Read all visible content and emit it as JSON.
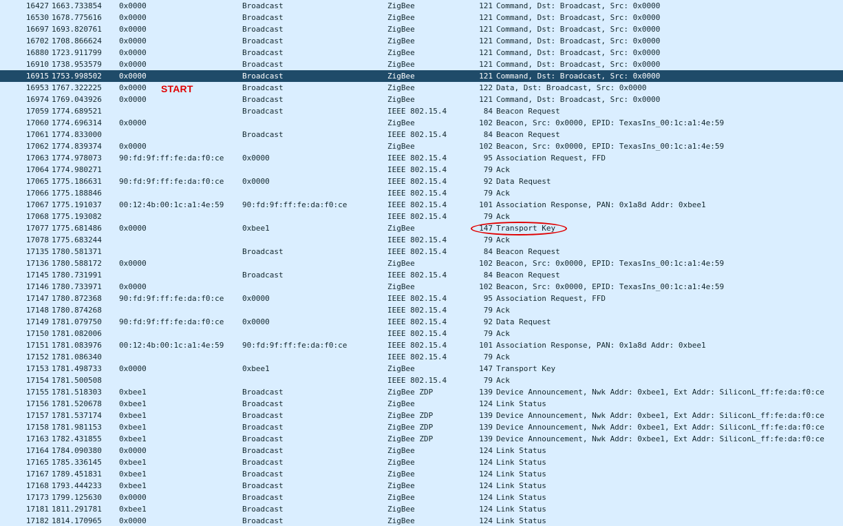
{
  "annotations": {
    "start_label": "START",
    "circle_color": "#e00000"
  },
  "colors": {
    "row_bg": "#daeeff",
    "selected_bg": "#1f4b69"
  },
  "selected_row": 6,
  "packets": [
    {
      "no": "16427",
      "time": "1663.733854",
      "src": "0x0000",
      "dst": "Broadcast",
      "proto": "ZigBee",
      "len": "121",
      "info": "Command, Dst: Broadcast, Src: 0x0000"
    },
    {
      "no": "16530",
      "time": "1678.775616",
      "src": "0x0000",
      "dst": "Broadcast",
      "proto": "ZigBee",
      "len": "121",
      "info": "Command, Dst: Broadcast, Src: 0x0000"
    },
    {
      "no": "16697",
      "time": "1693.820761",
      "src": "0x0000",
      "dst": "Broadcast",
      "proto": "ZigBee",
      "len": "121",
      "info": "Command, Dst: Broadcast, Src: 0x0000"
    },
    {
      "no": "16702",
      "time": "1708.866624",
      "src": "0x0000",
      "dst": "Broadcast",
      "proto": "ZigBee",
      "len": "121",
      "info": "Command, Dst: Broadcast, Src: 0x0000"
    },
    {
      "no": "16880",
      "time": "1723.911799",
      "src": "0x0000",
      "dst": "Broadcast",
      "proto": "ZigBee",
      "len": "121",
      "info": "Command, Dst: Broadcast, Src: 0x0000"
    },
    {
      "no": "16910",
      "time": "1738.953579",
      "src": "0x0000",
      "dst": "Broadcast",
      "proto": "ZigBee",
      "len": "121",
      "info": "Command, Dst: Broadcast, Src: 0x0000"
    },
    {
      "no": "16915",
      "time": "1753.998502",
      "src": "0x0000",
      "dst": "Broadcast",
      "proto": "ZigBee",
      "len": "121",
      "info": "Command, Dst: Broadcast, Src: 0x0000"
    },
    {
      "no": "16953",
      "time": "1767.322225",
      "src": "0x0000",
      "dst": "Broadcast",
      "proto": "ZigBee",
      "len": "122",
      "info": "Data, Dst: Broadcast, Src: 0x0000"
    },
    {
      "no": "16974",
      "time": "1769.043926",
      "src": "0x0000",
      "dst": "Broadcast",
      "proto": "ZigBee",
      "len": "121",
      "info": "Command, Dst: Broadcast, Src: 0x0000"
    },
    {
      "no": "17059",
      "time": "1774.689521",
      "src": "",
      "dst": "Broadcast",
      "proto": "IEEE 802.15.4",
      "len": "84",
      "info": "Beacon Request"
    },
    {
      "no": "17060",
      "time": "1774.696314",
      "src": "0x0000",
      "dst": "",
      "proto": "ZigBee",
      "len": "102",
      "info": "Beacon, Src: 0x0000, EPID: TexasIns_00:1c:a1:4e:59"
    },
    {
      "no": "17061",
      "time": "1774.833000",
      "src": "",
      "dst": "Broadcast",
      "proto": "IEEE 802.15.4",
      "len": "84",
      "info": "Beacon Request"
    },
    {
      "no": "17062",
      "time": "1774.839374",
      "src": "0x0000",
      "dst": "",
      "proto": "ZigBee",
      "len": "102",
      "info": "Beacon, Src: 0x0000, EPID: TexasIns_00:1c:a1:4e:59"
    },
    {
      "no": "17063",
      "time": "1774.978073",
      "src": "90:fd:9f:ff:fe:da:f0:ce",
      "dst": "0x0000",
      "proto": "IEEE 802.15.4",
      "len": "95",
      "info": "Association Request, FFD"
    },
    {
      "no": "17064",
      "time": "1774.980271",
      "src": "",
      "dst": "",
      "proto": "IEEE 802.15.4",
      "len": "79",
      "info": "Ack"
    },
    {
      "no": "17065",
      "time": "1775.186631",
      "src": "90:fd:9f:ff:fe:da:f0:ce",
      "dst": "0x0000",
      "proto": "IEEE 802.15.4",
      "len": "92",
      "info": "Data Request"
    },
    {
      "no": "17066",
      "time": "1775.188846",
      "src": "",
      "dst": "",
      "proto": "IEEE 802.15.4",
      "len": "79",
      "info": "Ack"
    },
    {
      "no": "17067",
      "time": "1775.191037",
      "src": "00:12:4b:00:1c:a1:4e:59",
      "dst": "90:fd:9f:ff:fe:da:f0:ce",
      "proto": "IEEE 802.15.4",
      "len": "101",
      "info": "Association Response, PAN: 0x1a8d Addr: 0xbee1"
    },
    {
      "no": "17068",
      "time": "1775.193082",
      "src": "",
      "dst": "",
      "proto": "IEEE 802.15.4",
      "len": "79",
      "info": "Ack"
    },
    {
      "no": "17077",
      "time": "1775.681486",
      "src": "0x0000",
      "dst": "0xbee1",
      "proto": "ZigBee",
      "len": "147",
      "info": "Transport Key"
    },
    {
      "no": "17078",
      "time": "1775.683244",
      "src": "",
      "dst": "",
      "proto": "IEEE 802.15.4",
      "len": "79",
      "info": "Ack"
    },
    {
      "no": "17135",
      "time": "1780.581371",
      "src": "",
      "dst": "Broadcast",
      "proto": "IEEE 802.15.4",
      "len": "84",
      "info": "Beacon Request"
    },
    {
      "no": "17136",
      "time": "1780.588172",
      "src": "0x0000",
      "dst": "",
      "proto": "ZigBee",
      "len": "102",
      "info": "Beacon, Src: 0x0000, EPID: TexasIns_00:1c:a1:4e:59"
    },
    {
      "no": "17145",
      "time": "1780.731991",
      "src": "",
      "dst": "Broadcast",
      "proto": "IEEE 802.15.4",
      "len": "84",
      "info": "Beacon Request"
    },
    {
      "no": "17146",
      "time": "1780.733971",
      "src": "0x0000",
      "dst": "",
      "proto": "ZigBee",
      "len": "102",
      "info": "Beacon, Src: 0x0000, EPID: TexasIns_00:1c:a1:4e:59"
    },
    {
      "no": "17147",
      "time": "1780.872368",
      "src": "90:fd:9f:ff:fe:da:f0:ce",
      "dst": "0x0000",
      "proto": "IEEE 802.15.4",
      "len": "95",
      "info": "Association Request, FFD"
    },
    {
      "no": "17148",
      "time": "1780.874268",
      "src": "",
      "dst": "",
      "proto": "IEEE 802.15.4",
      "len": "79",
      "info": "Ack"
    },
    {
      "no": "17149",
      "time": "1781.079750",
      "src": "90:fd:9f:ff:fe:da:f0:ce",
      "dst": "0x0000",
      "proto": "IEEE 802.15.4",
      "len": "92",
      "info": "Data Request"
    },
    {
      "no": "17150",
      "time": "1781.082006",
      "src": "",
      "dst": "",
      "proto": "IEEE 802.15.4",
      "len": "79",
      "info": "Ack"
    },
    {
      "no": "17151",
      "time": "1781.083976",
      "src": "00:12:4b:00:1c:a1:4e:59",
      "dst": "90:fd:9f:ff:fe:da:f0:ce",
      "proto": "IEEE 802.15.4",
      "len": "101",
      "info": "Association Response, PAN: 0x1a8d Addr: 0xbee1"
    },
    {
      "no": "17152",
      "time": "1781.086340",
      "src": "",
      "dst": "",
      "proto": "IEEE 802.15.4",
      "len": "79",
      "info": "Ack"
    },
    {
      "no": "17153",
      "time": "1781.498733",
      "src": "0x0000",
      "dst": "0xbee1",
      "proto": "ZigBee",
      "len": "147",
      "info": "Transport Key"
    },
    {
      "no": "17154",
      "time": "1781.500508",
      "src": "",
      "dst": "",
      "proto": "IEEE 802.15.4",
      "len": "79",
      "info": "Ack"
    },
    {
      "no": "17155",
      "time": "1781.518303",
      "src": "0xbee1",
      "dst": "Broadcast",
      "proto": "ZigBee ZDP",
      "len": "139",
      "info": "Device Announcement, Nwk Addr: 0xbee1, Ext Addr: SiliconL_ff:fe:da:f0:ce"
    },
    {
      "no": "17156",
      "time": "1781.520678",
      "src": "0xbee1",
      "dst": "Broadcast",
      "proto": "ZigBee",
      "len": "124",
      "info": "Link Status"
    },
    {
      "no": "17157",
      "time": "1781.537174",
      "src": "0xbee1",
      "dst": "Broadcast",
      "proto": "ZigBee ZDP",
      "len": "139",
      "info": "Device Announcement, Nwk Addr: 0xbee1, Ext Addr: SiliconL_ff:fe:da:f0:ce"
    },
    {
      "no": "17158",
      "time": "1781.981153",
      "src": "0xbee1",
      "dst": "Broadcast",
      "proto": "ZigBee ZDP",
      "len": "139",
      "info": "Device Announcement, Nwk Addr: 0xbee1, Ext Addr: SiliconL_ff:fe:da:f0:ce"
    },
    {
      "no": "17163",
      "time": "1782.431855",
      "src": "0xbee1",
      "dst": "Broadcast",
      "proto": "ZigBee ZDP",
      "len": "139",
      "info": "Device Announcement, Nwk Addr: 0xbee1, Ext Addr: SiliconL_ff:fe:da:f0:ce"
    },
    {
      "no": "17164",
      "time": "1784.090380",
      "src": "0x0000",
      "dst": "Broadcast",
      "proto": "ZigBee",
      "len": "124",
      "info": "Link Status"
    },
    {
      "no": "17165",
      "time": "1785.336145",
      "src": "0xbee1",
      "dst": "Broadcast",
      "proto": "ZigBee",
      "len": "124",
      "info": "Link Status"
    },
    {
      "no": "17167",
      "time": "1789.451831",
      "src": "0xbee1",
      "dst": "Broadcast",
      "proto": "ZigBee",
      "len": "124",
      "info": "Link Status"
    },
    {
      "no": "17168",
      "time": "1793.444233",
      "src": "0xbee1",
      "dst": "Broadcast",
      "proto": "ZigBee",
      "len": "124",
      "info": "Link Status"
    },
    {
      "no": "17173",
      "time": "1799.125630",
      "src": "0x0000",
      "dst": "Broadcast",
      "proto": "ZigBee",
      "len": "124",
      "info": "Link Status"
    },
    {
      "no": "17181",
      "time": "1811.291781",
      "src": "0xbee1",
      "dst": "Broadcast",
      "proto": "ZigBee",
      "len": "124",
      "info": "Link Status"
    },
    {
      "no": "17182",
      "time": "1814.170965",
      "src": "0x0000",
      "dst": "Broadcast",
      "proto": "ZigBee",
      "len": "124",
      "info": "Link Status"
    }
  ]
}
